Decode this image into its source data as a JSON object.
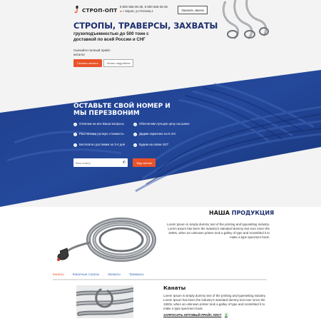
{
  "brand": {
    "name": "СТРОП-ОПТ"
  },
  "contacts": {
    "phones": "8 800 555-35-35, 8 800 555-35-35",
    "address": "г. Киров, ул.Попова,1"
  },
  "header": {
    "call_button": "Заказать звонок"
  },
  "hero": {
    "title": "СТРОПЫ, ТРАВЕРСЫ, ЗАХВАТЫ",
    "subtitle": "грузоподъемностью до 500 тонн с доставкой по всей России и СНГ",
    "note": "Скачайте полный прайс-каталог",
    "catalog_button": "Скачать каталог",
    "more_button": "Узнать подробнее"
  },
  "callback": {
    "title": "ОСТАВЬТЕ СВОЙ НОМЕР И МЫ ПЕРЕЗВОНИМ",
    "benefits": [
      "Ответим на все Ваши вопросы",
      "Обеспечим лучшую цену на рынке",
      "Рассчитаем полную стоимость",
      "Дадим гарантию на 5 лет",
      "Бесплатно доставим за 3-4 дня",
      "Будем на связи 24/7"
    ],
    "phone_placeholder": "Ваш номер",
    "submit_button": "Жду звонка"
  },
  "products": {
    "title_prefix": "НАША ",
    "title_accent": "ПРОДУКЦИЯ",
    "description": "Lorem Ipsum is simply dummy text of the printing and typesetting industry. Lorem Ipsum has been the industry's standard dummy text ever since the 1500s, when an unknown printer took a galley of type and scrambled it to make a type specimen book.",
    "tabs": [
      "Канаты",
      "Канатные стропы",
      "Захваты",
      "Траверсы"
    ],
    "active_tab": 0,
    "item": {
      "title": "Канаты",
      "description": "Lorem Ipsum is simply dummy text of the printing and typesetting industry. Lorem Ipsum has been the industry's standard dummy text ever since the 1500s, when an unknown printer took a galley of type and scrambled it to make a type specimen book.",
      "price_link": "ЗАПРОСИТЬ ОПТОВЫЙ ПРАЙС ЛИСТ"
    }
  },
  "colors": {
    "accent": "#e9532a",
    "brand_blue": "#1c2f6e",
    "band_blue": "#1f3f8c",
    "tab_link": "#3a6fb5"
  }
}
